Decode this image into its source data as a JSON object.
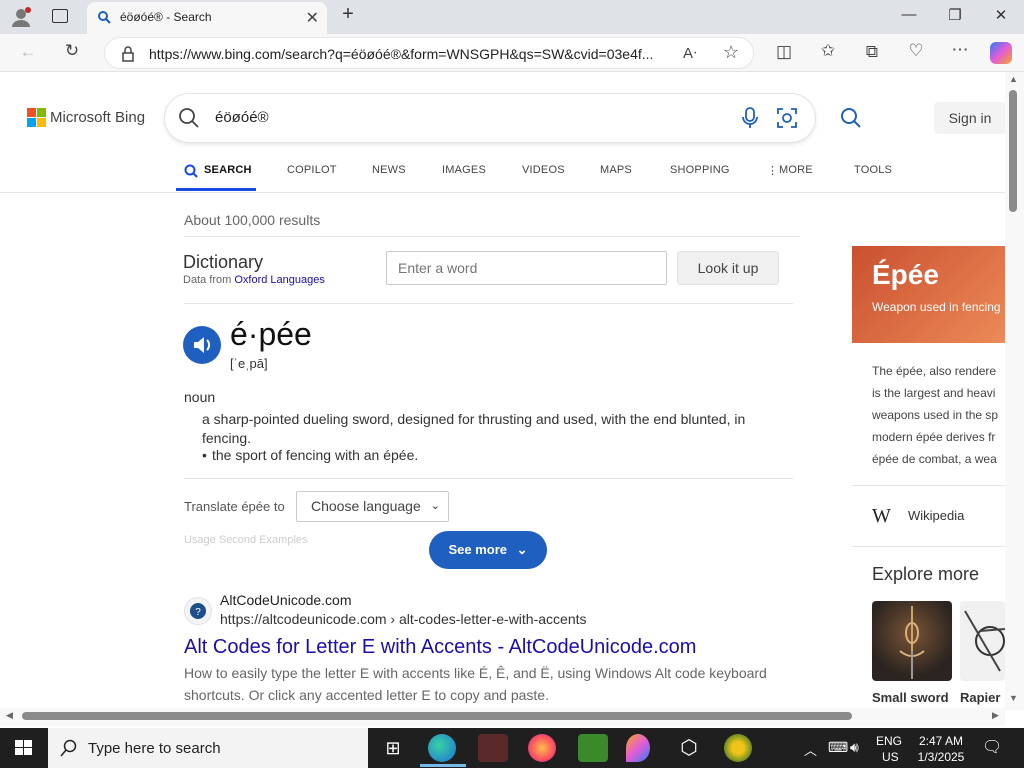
{
  "browser": {
    "tab_title": "éöøóé® - Search",
    "url": "https://www.bing.com/search?q=éöøóé®&form=WNSGPH&qs=SW&cvid=03e4f..."
  },
  "bing": {
    "brand": "Microsoft Bing",
    "query": "éöøóé®",
    "sign_in": "Sign in",
    "scopes": [
      "SEARCH",
      "COPILOT",
      "NEWS",
      "IMAGES",
      "VIDEOS",
      "MAPS",
      "SHOPPING",
      "MORE",
      "TOOLS"
    ],
    "result_count": "About 100,000 results"
  },
  "dictionary": {
    "title": "Dictionary",
    "source_prefix": "Data from ",
    "source_link": "Oxford Languages",
    "input_placeholder": "Enter a word",
    "lookup_button": "Look it up",
    "headword": "é·pée",
    "pronunciation": "[ˈeˌpā]",
    "part_of_speech": "noun",
    "definition_1": "a sharp-pointed dueling sword, designed for thrusting and used, with the end blunted, in fencing.",
    "definition_2": "the sport of fencing with an épée.",
    "translate_label": "Translate épée to",
    "language_select": "Choose language",
    "faded_text": "Usage Second Examples",
    "see_more": "See more"
  },
  "web_result": {
    "site_name": "AltCodeUnicode.com",
    "site_url": "https://altcodeunicode.com › alt-codes-letter-e-with-accents",
    "title": "Alt Codes for Letter E with Accents - AltCodeUnicode.com",
    "snippet": "How to easily type the letter E with accents like É, Ê, and Ë, using Windows Alt code keyboard shortcuts. Or click any accented letter E to copy and paste."
  },
  "knowledge_panel": {
    "title": "Épée",
    "subtitle": "Weapon used in fencing",
    "description": "The épée, also rendered is the largest and heavi weapons used in the sp modern épée derives fr épée de combat, a wea",
    "desc_lines": [
      "The épée, also rendere",
      "is the largest and heavi",
      "weapons used in the sp",
      "modern épée derives fr",
      "épée de combat, a wea"
    ],
    "wiki_label": "Wikipedia",
    "explore_more": "Explore more",
    "thumb_1": "Small sword",
    "thumb_2": "Rapier"
  },
  "taskbar": {
    "search_placeholder": "Type here to search",
    "lang_1": "ENG",
    "lang_2": "US",
    "time": "2:47 AM",
    "date": "1/3/2025"
  }
}
